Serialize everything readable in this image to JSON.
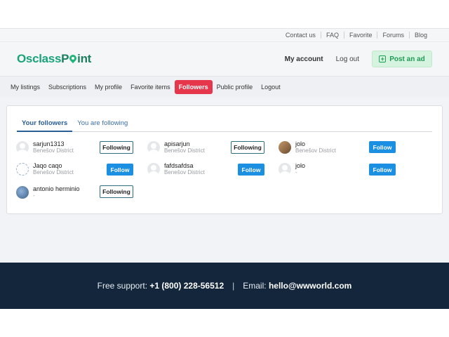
{
  "topbar": {
    "links": [
      "Contact us",
      "FAQ",
      "Favorite",
      "Forums",
      "Blog"
    ]
  },
  "header": {
    "logo_part1": "Osclass",
    "logo_part2": "P",
    "logo_part3": "int",
    "my_account": "My account",
    "log_out": "Log out",
    "post_ad": "Post an ad"
  },
  "user_nav": {
    "items": [
      "My listings",
      "Subscriptions",
      "My profile",
      "Favorite items",
      "Followers",
      "Public profile",
      "Logout"
    ],
    "active": "Followers"
  },
  "tabs": {
    "your_followers": "Your followers",
    "you_are_following": "You are following"
  },
  "users": [
    {
      "name": "sarjun1313",
      "location": "Benešov District",
      "button": "Following",
      "avatar": "generic"
    },
    {
      "name": "apisarjun",
      "location": "Benešov District",
      "button": "Following",
      "avatar": "generic"
    },
    {
      "name": "jolo",
      "location": "Benešov District",
      "button": "Follow",
      "avatar": "photo"
    },
    {
      "name": "Jaqo caqo",
      "location": "Benešov District",
      "button": "Follow",
      "avatar": "sketch"
    },
    {
      "name": "fafdsafdsa",
      "location": "Benešov District",
      "button": "Follow",
      "avatar": "generic"
    },
    {
      "name": "jolo",
      "location": "-",
      "button": "Follow",
      "avatar": "generic"
    },
    {
      "name": "antonio herminio",
      "location": "-",
      "button": "Following",
      "avatar": "scene"
    }
  ],
  "footer": {
    "support_label": "Free support:",
    "support_phone": "+1 (800) 228-56512",
    "separator": "|",
    "email_label": "Email:",
    "email": "hello@wwworld.com"
  },
  "colors": {
    "brand_green": "#1aa37a",
    "active_tab_red": "#e5364c",
    "follow_blue": "#1b8fe2",
    "footer_navy": "#13263c"
  }
}
